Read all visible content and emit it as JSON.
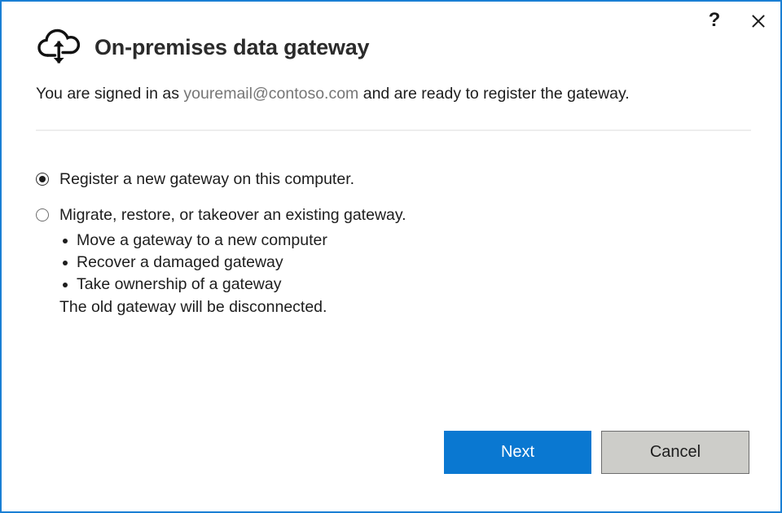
{
  "window": {
    "border_color": "#1a7fd4",
    "controls": [
      {
        "name": "help",
        "glyph": "?"
      },
      {
        "name": "close",
        "glyph": "✕"
      }
    ]
  },
  "header": {
    "icon": "cloud-upload-download-icon",
    "title": "On-premises data gateway"
  },
  "status": {
    "prefix": "You are signed in as ",
    "email": "youremail@contoso.com",
    "suffix": " and are ready to register the gateway.",
    "email_color": "#767676"
  },
  "options": {
    "register": {
      "label": "Register a new gateway on this computer.",
      "selected": true
    },
    "migrate": {
      "label": "Migrate, restore, or takeover an existing gateway.",
      "selected": false,
      "bullets": [
        "Move a gateway to a new computer",
        "Recover a damaged gateway",
        "Take ownership of a gateway"
      ],
      "note": "The old gateway will be disconnected."
    }
  },
  "footer": {
    "next_label": "Next",
    "cancel_label": "Cancel",
    "next_color": "#0a78d1",
    "cancel_color": "#cdcdc9"
  }
}
